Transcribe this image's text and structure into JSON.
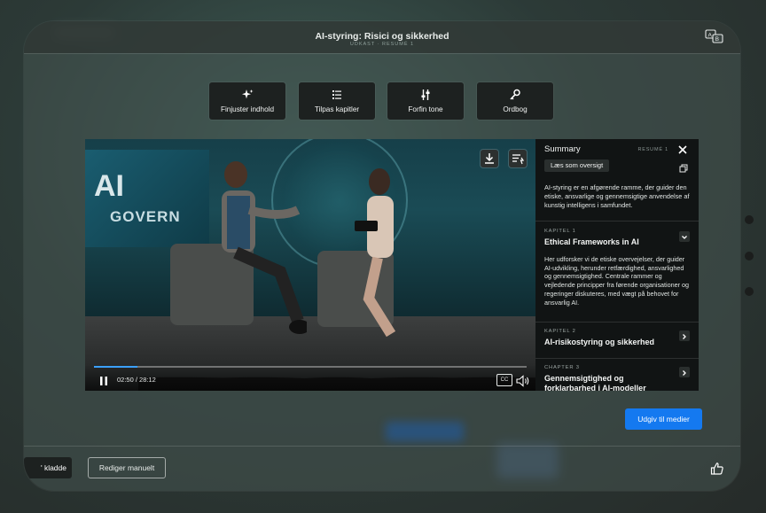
{
  "window": {
    "title": "AI-styring: Risici og sikkerhed",
    "subtitle": "UDKAST · RESUMÉ 1"
  },
  "toolbar": [
    {
      "label": "Finjuster indhold",
      "icon": "sparkle-icon"
    },
    {
      "label": "Tilpas kapitler",
      "icon": "list-icon"
    },
    {
      "label": "Forfin tone",
      "icon": "sliders-icon"
    },
    {
      "label": "Ordbog",
      "icon": "key-icon"
    }
  ],
  "video": {
    "screen_line1": "AI",
    "screen_line2": "GOVERN",
    "time": "02:50 / 28:12",
    "progress": 0.1,
    "cc_label": "CC"
  },
  "summary": {
    "heading": "Summary",
    "tag": "RESUMÉ 1",
    "read_button": "Læs som oversigt",
    "intro": "AI-styring er en afgørende ramme, der guider den etiske, ansvarlige og gennemsigtige anvendelse af kunstig intelligens i samfundet.",
    "chapters": [
      {
        "label": "KAPITEL 1",
        "title": "Ethical Frameworks in AI",
        "description": "Her udforsker vi de etiske overvejelser, der guider AI-udvikling, herunder retfærdighed, ansvarlighed og gennemsigtighed. Centrale rammer og vejledende principper fra førende organisationer og regeringer diskuteres, med vægt på behovet for ansvarlig AI."
      },
      {
        "label": "KAPITEL 2",
        "title": "AI-risikostyring og sikkerhed"
      },
      {
        "label": "CHAPTER 3",
        "title": "Gennemsigtighed og forklarbarhed i AI-modeller"
      }
    ]
  },
  "actions": {
    "publish": "Udgiv til medier",
    "draft": "' kladde",
    "edit": "Rediger manuelt"
  },
  "colors": {
    "accent": "#1479f0",
    "panel_bg": "#111414",
    "button_bg": "#1d2120"
  }
}
